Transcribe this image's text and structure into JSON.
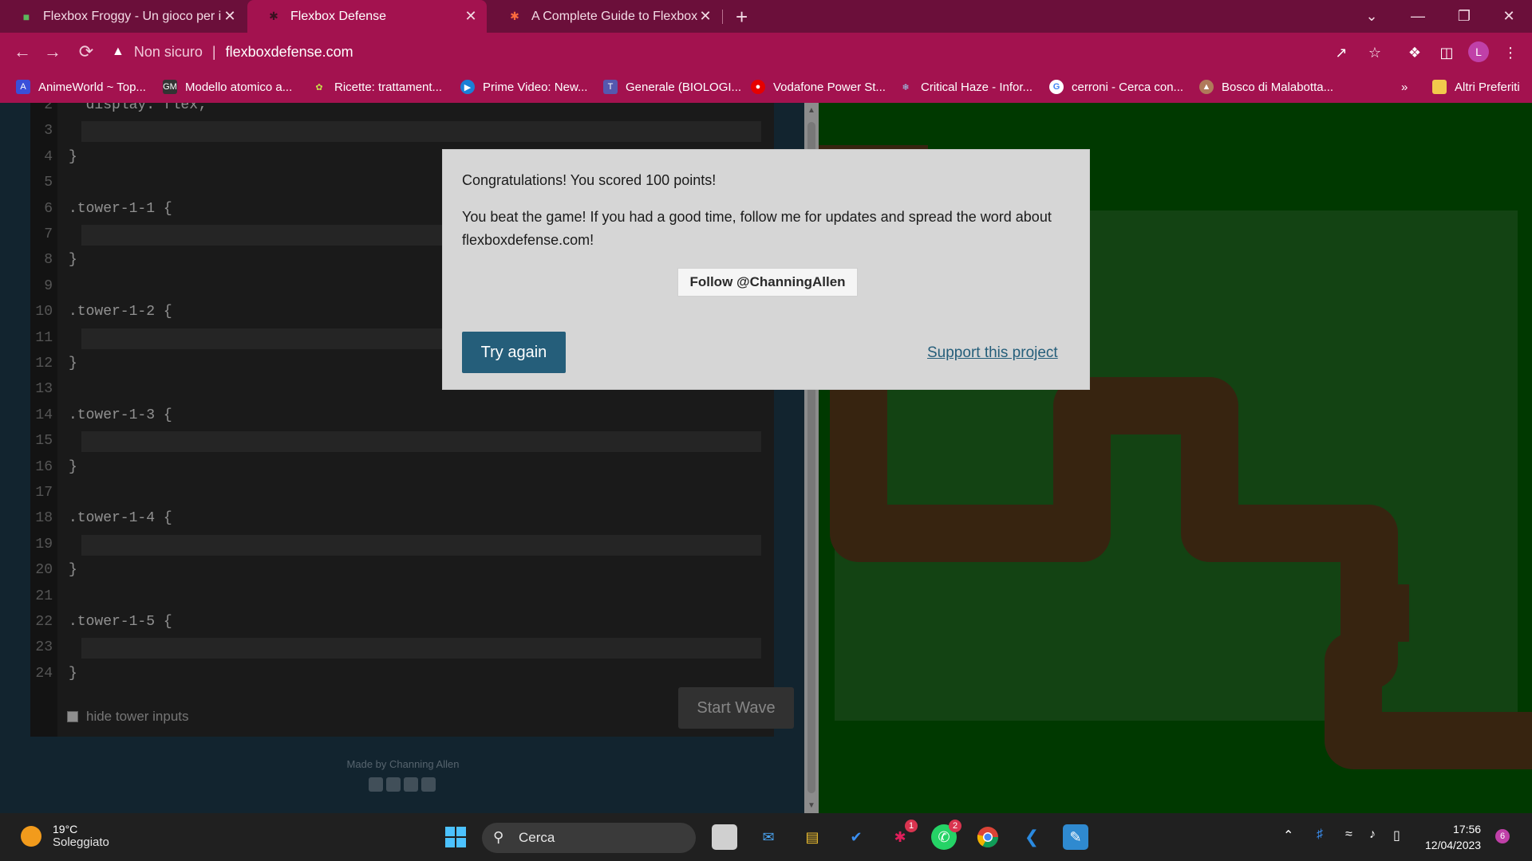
{
  "browser": {
    "tabs": [
      {
        "title": "Flexbox Froggy - Un gioco per im",
        "favicon": "frog-icon"
      },
      {
        "title": "Flexbox Defense",
        "favicon": "flexbox-defense-icon"
      },
      {
        "title": "A Complete Guide to Flexbox | C",
        "favicon": "css-tricks-icon"
      }
    ],
    "new_tab": "+",
    "address": {
      "security_label": "Non sicuro",
      "url": "flexboxdefense.com"
    },
    "profile_initial": "L",
    "bookmarks": [
      {
        "label": "AnimeWorld ~ Top...",
        "color": "#3a4fd9"
      },
      {
        "label": "Modello atomico a...",
        "color": "#333333"
      },
      {
        "label": "Ricette: trattament...",
        "color": "#8bbf2a"
      },
      {
        "label": "Prime Video: New...",
        "color": "#1b7fd6"
      },
      {
        "label": "Generale (BIOLOGI...",
        "color": "#5558af"
      },
      {
        "label": "Vodafone Power St...",
        "color": "#e60000"
      },
      {
        "label": "Critical Haze - Infor...",
        "color": "#4a8fd9"
      },
      {
        "label": "cerroni - Cerca con...",
        "color": "#ffffff"
      },
      {
        "label": "Bosco di Malabotta...",
        "color": "#b07a5a"
      }
    ],
    "bookmarks_overflow": "»",
    "other_bookmarks": "Altri Preferiti"
  },
  "editor": {
    "lines": [
      {
        "n": "2",
        "code": "  display: flex;",
        "input": false
      },
      {
        "n": "3",
        "code": "",
        "input": true
      },
      {
        "n": "4",
        "code": "}",
        "input": false
      },
      {
        "n": "5",
        "code": "",
        "input": false
      },
      {
        "n": "6",
        "code": ".tower-1-1 {",
        "input": false
      },
      {
        "n": "7",
        "code": "",
        "input": true
      },
      {
        "n": "8",
        "code": "}",
        "input": false
      },
      {
        "n": "9",
        "code": "",
        "input": false
      },
      {
        "n": "10",
        "code": ".tower-1-2 {",
        "input": false
      },
      {
        "n": "11",
        "code": "",
        "input": true
      },
      {
        "n": "12",
        "code": "}",
        "input": false
      },
      {
        "n": "13",
        "code": "",
        "input": false
      },
      {
        "n": "14",
        "code": ".tower-1-3 {",
        "input": false
      },
      {
        "n": "15",
        "code": "",
        "input": true
      },
      {
        "n": "16",
        "code": "}",
        "input": false
      },
      {
        "n": "17",
        "code": "",
        "input": false
      },
      {
        "n": "18",
        "code": ".tower-1-4 {",
        "input": false
      },
      {
        "n": "19",
        "code": "",
        "input": true
      },
      {
        "n": "20",
        "code": "}",
        "input": false
      },
      {
        "n": "21",
        "code": "",
        "input": false
      },
      {
        "n": "22",
        "code": ".tower-1-5 {",
        "input": false
      },
      {
        "n": "23",
        "code": "",
        "input": true
      },
      {
        "n": "24",
        "code": "}",
        "input": false
      }
    ],
    "hide_inputs_label": "hide tower inputs",
    "start_wave_label": "Start Wave",
    "made_by": "Made by Channing Allen"
  },
  "game": {
    "field_color": "#1f6d1f",
    "path_color": "#5a3a1a",
    "background_color": "#005c00"
  },
  "modal": {
    "score_text": "Congratulations! You scored 100 points!",
    "message": "You beat the game! If you had a good time, follow me for updates and spread the word about flexboxdefense.com!",
    "follow_label": "Follow @ChanningAllen",
    "try_again_label": "Try again",
    "support_label": "Support this project"
  },
  "taskbar": {
    "weather_temp": "19°C",
    "weather_desc": "Soleggiato",
    "search_label": "Cerca",
    "apps": [
      {
        "name": "windows-start-icon",
        "badge": ""
      },
      {
        "name": "task-view-icon",
        "badge": ""
      },
      {
        "name": "mail-icon",
        "badge": ""
      },
      {
        "name": "file-explorer-icon",
        "badge": ""
      },
      {
        "name": "todo-icon",
        "badge": ""
      },
      {
        "name": "slack-icon",
        "badge": "1"
      },
      {
        "name": "whatsapp-icon",
        "badge": "2"
      },
      {
        "name": "chrome-icon",
        "badge": ""
      },
      {
        "name": "vscode-icon",
        "badge": ""
      },
      {
        "name": "paint-icon",
        "badge": ""
      }
    ],
    "time": "17:56",
    "date": "12/04/2023",
    "notifications": "6"
  }
}
